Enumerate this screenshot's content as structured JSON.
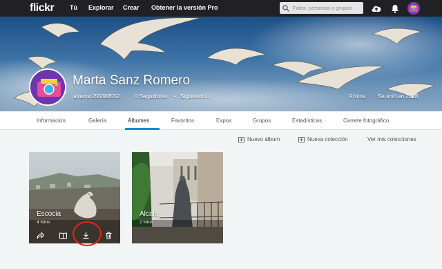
{
  "app": {
    "logo": "flickr"
  },
  "nav": {
    "items": [
      "Tú",
      "Explorar",
      "Crear",
      "Obtener la versión Pro"
    ]
  },
  "search": {
    "placeholder": "Fotos, personas o grupos"
  },
  "header_icons": [
    "upload-cloud-icon",
    "bell-icon",
    "avatar"
  ],
  "profile": {
    "name": "Marta Sanz Romero",
    "username": "atramsr255888552",
    "followers": "0 Seguidores",
    "separator": "•",
    "following": "Siguiendo 0",
    "photos": "9 fotos",
    "joined": "Se unió en 2018"
  },
  "tabs": [
    "Información",
    "Galería",
    "Álbumes",
    "Favoritos",
    "Expos",
    "Grupos",
    "Estadísticas",
    "Carrete fotográfico"
  ],
  "active_tab": "Álbumes",
  "actions": {
    "new_album": "Nuevo álbum",
    "new_collection": "Nueva colección",
    "view_collections": "Ver mis colecciones"
  },
  "albums": [
    {
      "title": "Escocia",
      "count": "4 fotos",
      "actions": [
        "share-icon",
        "book-icon",
        "download-icon",
        "trash-icon"
      ]
    },
    {
      "title": "Alcalá",
      "count": "2 fotos"
    }
  ],
  "colors": {
    "topbar": "#212124",
    "accent_underline": "#008ecf",
    "highlight_circle": "#e0261a",
    "avatar_purple": "#6d35b0"
  }
}
